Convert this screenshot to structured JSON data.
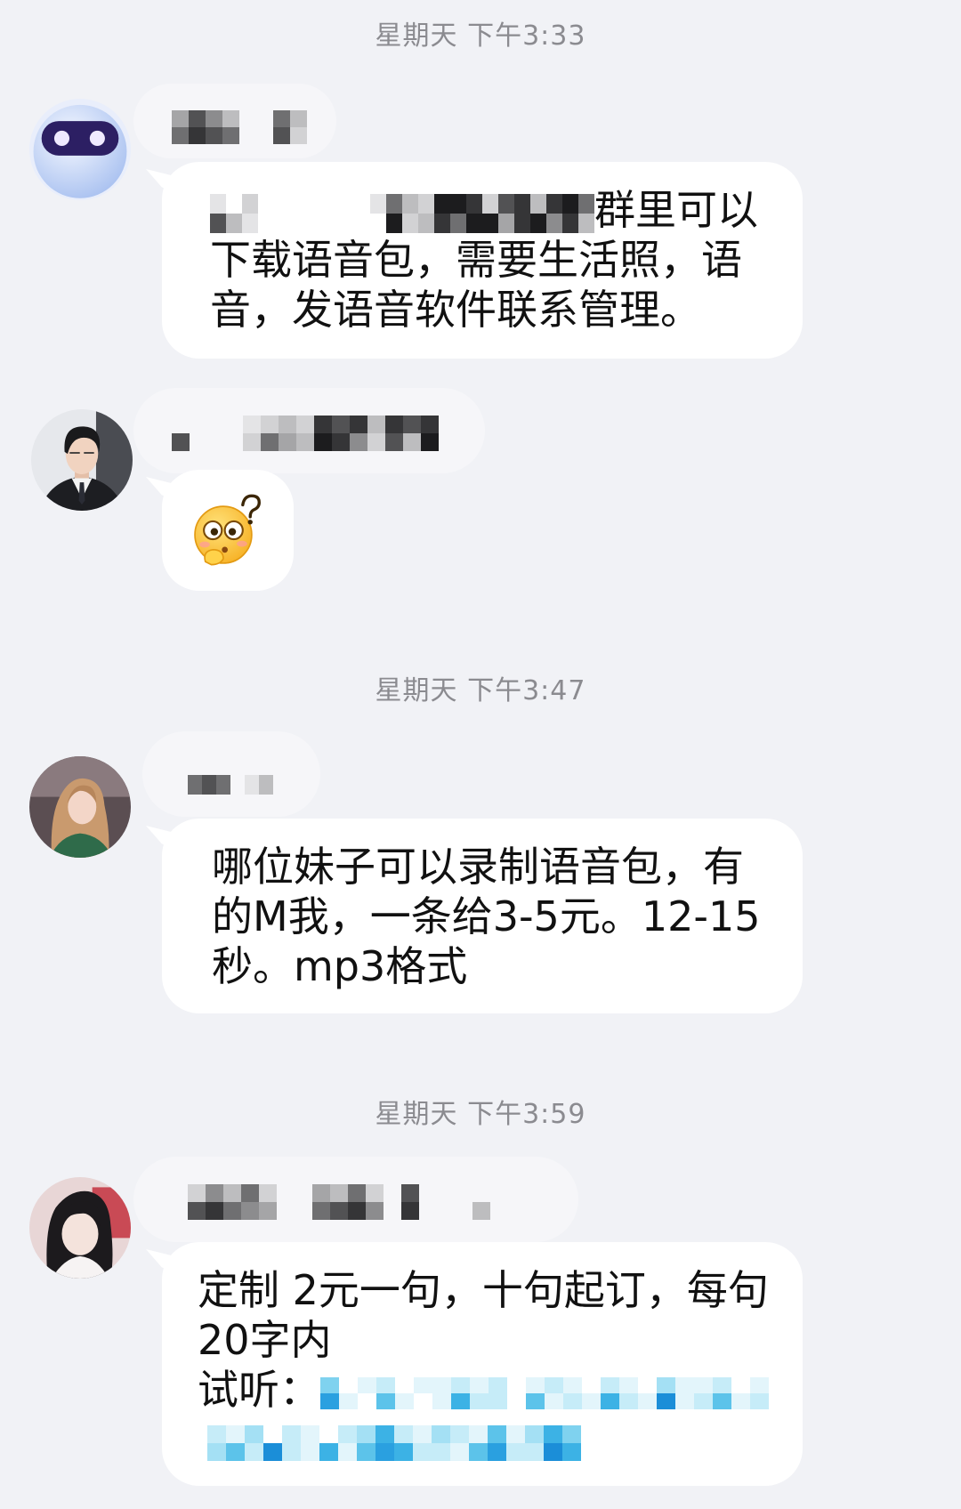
{
  "colors": {
    "background": "#f1f2f6",
    "bubble": "#ffffff",
    "text": "#111111",
    "timestamp": "#8b8b90",
    "link": "#2aa0e0"
  },
  "timestamps": [
    "星期天 下午3:33",
    "星期天 下午3:47",
    "星期天 下午3:59"
  ],
  "messages": [
    {
      "avatar_icon": "robot-avatar",
      "lines": [
        "群里可以",
        "下载语音包，需要生活照，语",
        "音，发语音软件联系管理。"
      ]
    },
    {
      "avatar_icon": "man-in-suit-avatar",
      "emoji_icon": "confused-face-emoji-icon"
    },
    {
      "avatar_icon": "long-hair-girl-avatar",
      "lines": [
        "哪位妹子可以录制语音包，有",
        "的M我，一条给3-5元。12-15",
        "秒。mp3格式"
      ]
    },
    {
      "avatar_icon": "girl-with-bangs-avatar",
      "lines": [
        "定制 2元一句，十句起订，每句",
        "20字内",
        "试听："
      ]
    }
  ]
}
